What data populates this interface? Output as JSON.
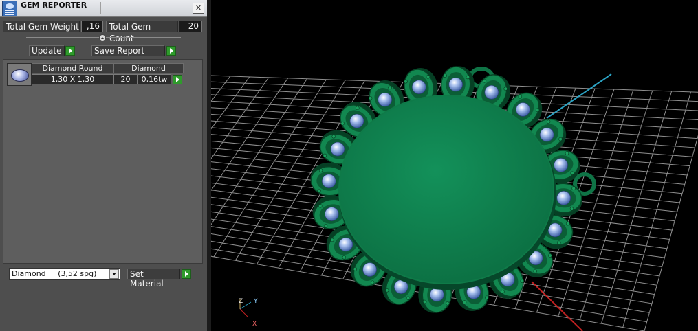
{
  "window": {
    "title": "GEM REPORTER",
    "close_symbol": "✕"
  },
  "totals": {
    "weight_label": "Total Gem Weight",
    "weight_value": ",16",
    "count_label": "Total Gem Count",
    "count_value": "20"
  },
  "actions": {
    "update_label": "Update",
    "save_report_label": "Save Report"
  },
  "gem_table": {
    "headers": [
      "Diamond Round",
      "Diamond"
    ],
    "rows": [
      {
        "size": "1,30 X 1,30",
        "count": "20",
        "weight": "0,16tw"
      }
    ]
  },
  "material": {
    "selected": "Diamond     (3,52 spg)",
    "set_label": "Set Material"
  },
  "viewport": {
    "axis_labels": {
      "z": "Z",
      "y": "Y",
      "x": "X"
    },
    "colors": {
      "background": "#000000",
      "grid": "#8f8f8f",
      "model": "#178a55",
      "gem": "#8fb0e6",
      "axis_x": "#c02020",
      "axis_y": "#2ba3c4"
    }
  },
  "icons": [
    "app-icon",
    "close-icon",
    "play-icon",
    "dropdown-arrow-icon",
    "gem-thumbnail"
  ]
}
